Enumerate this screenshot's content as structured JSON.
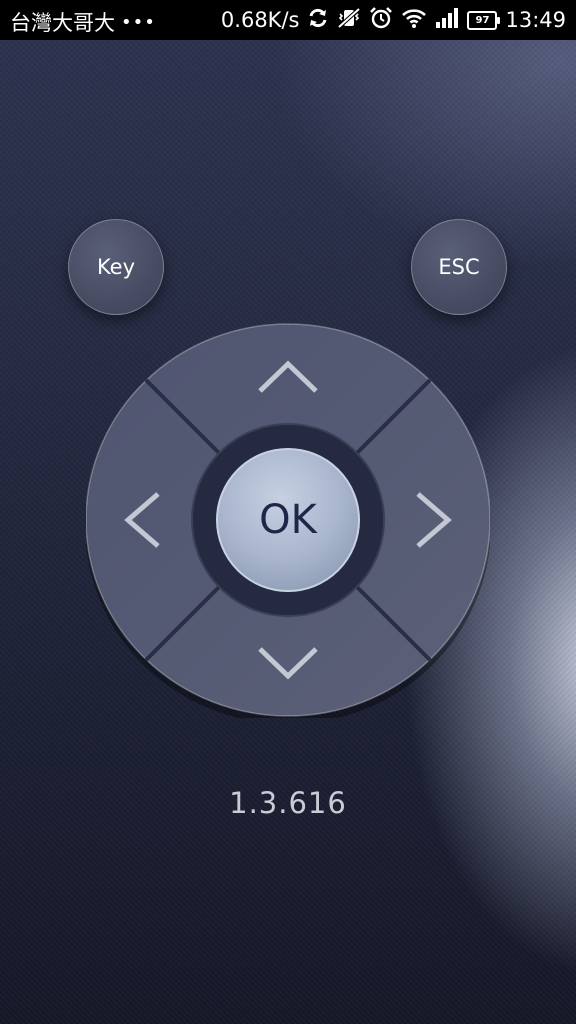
{
  "status_bar": {
    "carrier": "台灣大哥大",
    "dots": "•••",
    "speed": "0.68K/s",
    "battery": "97",
    "time": "13:49",
    "icons": [
      "sync-icon",
      "vibrate-off-icon",
      "alarm-icon",
      "wifi-icon",
      "signal-icon",
      "battery-icon"
    ]
  },
  "buttons": {
    "key": "Key",
    "esc": "ESC",
    "ok": "OK"
  },
  "dpad": {
    "icons": [
      "up-arrow-icon",
      "down-arrow-icon",
      "left-arrow-icon",
      "right-arrow-icon"
    ]
  },
  "version": "1.3.616",
  "colors": {
    "background": "#272c45",
    "button_face": "#4a4e66",
    "ok_button": "#a9b7cf",
    "text": "#ffffff"
  }
}
